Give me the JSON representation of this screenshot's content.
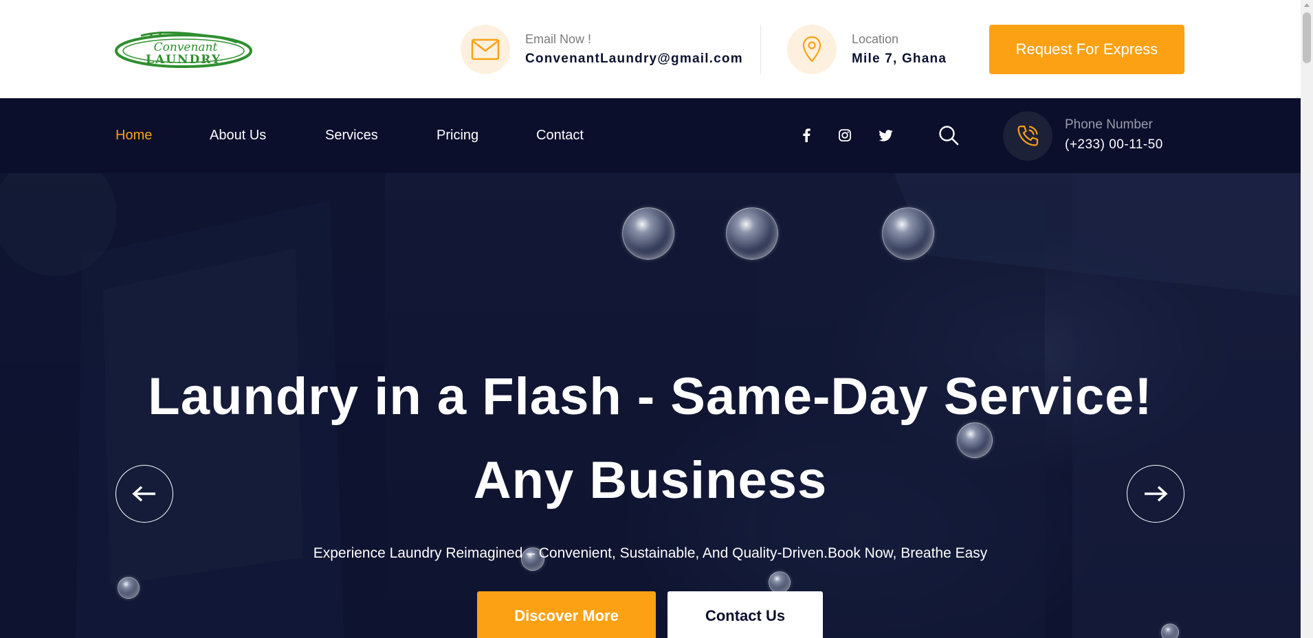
{
  "header": {
    "logo": {
      "script_text": "Convenant",
      "block_text": "LAUNDRY",
      "color": "#2f8f2f"
    },
    "email": {
      "label": "Email Now !",
      "value": "ConvenantLaundry@gmail.com",
      "icon": "envelope-icon"
    },
    "location": {
      "label": "Location",
      "value": "Mile 7, Ghana",
      "icon": "map-pin-icon"
    },
    "express_button": "Request For Express"
  },
  "nav": {
    "items": [
      {
        "label": "Home",
        "active": true
      },
      {
        "label": "About Us",
        "active": false
      },
      {
        "label": "Services",
        "active": false
      },
      {
        "label": "Pricing",
        "active": false
      },
      {
        "label": "Contact",
        "active": false
      }
    ],
    "social": [
      "facebook-icon",
      "instagram-icon",
      "twitter-icon"
    ],
    "search_icon": "search-icon",
    "phone": {
      "label": "Phone Number",
      "value": "(+233) 00-11-50",
      "icon": "phone-icon"
    }
  },
  "hero": {
    "title_line1": "Laundry in a Flash - Same-Day Service!",
    "title_line2": "Any Business",
    "subtitle": "Experience Laundry Reimagined – Convenient, Sustainable, And Quality-Driven.Book Now, Breathe Easy",
    "primary_button": "Discover More",
    "secondary_button": "Contact Us",
    "prev_icon": "arrow-left-icon",
    "next_icon": "arrow-right-icon"
  },
  "colors": {
    "accent": "#fca114",
    "nav_bg": "#0b0f2c",
    "text_dark": "#0c1230"
  }
}
